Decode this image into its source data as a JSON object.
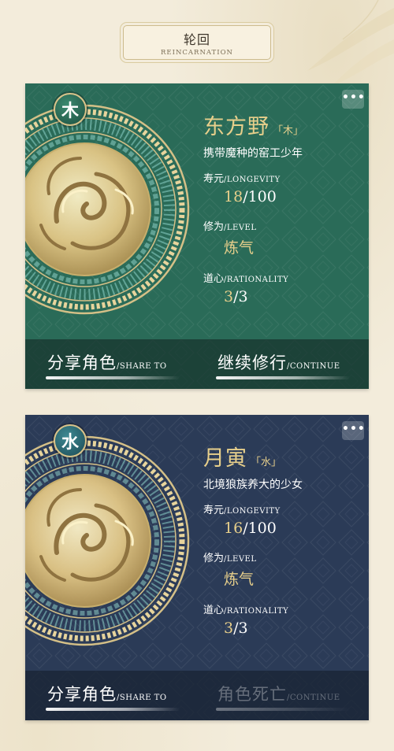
{
  "header": {
    "title": "轮回",
    "subtitle": "Reincarnation"
  },
  "menu_icon": "more-dots-icon",
  "cards": [
    {
      "element_glyph": "木",
      "name": "东方野",
      "element_tag": "「木」",
      "description": "携带魔种的窑工少年",
      "longevity_label": "寿元",
      "longevity_en": "/Longevity",
      "longevity_current": "18",
      "longevity_max": "/100",
      "level_label": "修为",
      "level_en": "/Level",
      "level_value": "炼气",
      "rationality_label": "道心",
      "rationality_en": "/Rationality",
      "rationality_current": "3",
      "rationality_max": "/3",
      "share_zh": "分享角色",
      "share_en": "/Share To",
      "continue_zh": "继续修行",
      "continue_en": "/Continue",
      "colors": {
        "card": "#2a6b58",
        "accent": "#e7cf8b"
      }
    },
    {
      "element_glyph": "水",
      "name": "月寅",
      "element_tag": "「水」",
      "description": "北境狼族养大的少女",
      "longevity_label": "寿元",
      "longevity_en": "/Longevity",
      "longevity_current": "16",
      "longevity_max": "/100",
      "level_label": "修为",
      "level_en": "/Level",
      "level_value": "炼气",
      "rationality_label": "道心",
      "rationality_en": "/Rationality",
      "rationality_current": "3",
      "rationality_max": "/3",
      "share_zh": "分享角色",
      "share_en": "/Share To",
      "continue_zh": "角色死亡",
      "continue_en": "/Continue",
      "colors": {
        "card": "#2b3b57",
        "accent": "#e7cf8b"
      }
    }
  ]
}
